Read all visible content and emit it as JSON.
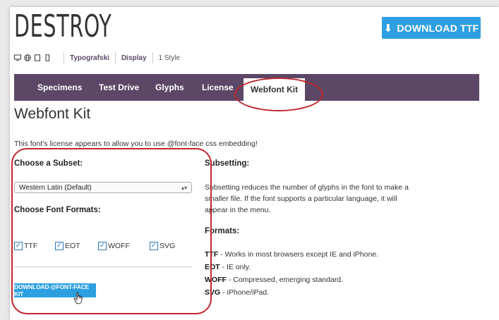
{
  "header": {
    "font_name": "DESTROY",
    "download_button": "DOWNLOAD TTF",
    "meta": {
      "icons": [
        "desktop-icon",
        "web-icon",
        "tablet-icon",
        "phone-icon"
      ],
      "foundry": "Typografski",
      "category": "Display",
      "styles": "1 Style"
    }
  },
  "tabs": [
    {
      "label": "Specimens",
      "active": false
    },
    {
      "label": "Test Drive",
      "active": false
    },
    {
      "label": "Glyphs",
      "active": false
    },
    {
      "label": "License",
      "active": false
    },
    {
      "label": "Webfont Kit",
      "active": true
    }
  ],
  "main": {
    "title": "Webfont Kit",
    "license_note": "This font's license appears to allow you to use @font-face css embedding!",
    "subset": {
      "label": "Choose a Subset:",
      "selected": "Western Latin (Default)"
    },
    "formats_label": "Choose Font Formats:",
    "checkboxes": [
      {
        "label": "TTF",
        "checked": true
      },
      {
        "label": "EOT",
        "checked": true
      },
      {
        "label": "WOFF",
        "checked": true
      },
      {
        "label": "SVG",
        "checked": true
      }
    ],
    "download_kit_button": "DOWNLOAD @FONT-FACE KIT"
  },
  "info": {
    "subsetting_heading": "Subsetting:",
    "subsetting_lines": [
      "Subsetting reduces the number of glyphs in the font to make a",
      "smaller file. If the font supports a particular language, it will",
      "appear in the menu."
    ],
    "formats_heading": "Formats:",
    "formats": [
      {
        "name": "TTF",
        "desc": " - Works in most browsers except IE and iPhone."
      },
      {
        "name": "EOT",
        "desc": " - IE only."
      },
      {
        "name": "WOFF",
        "desc": " - Compressed, emerging standard."
      },
      {
        "name": "SVG",
        "desc": " - iPhone/iPad."
      }
    ]
  },
  "colors": {
    "accent_blue": "#2d9fe0",
    "tab_bar_purple": "#5c4766",
    "annotation_red": "#c1272d"
  }
}
